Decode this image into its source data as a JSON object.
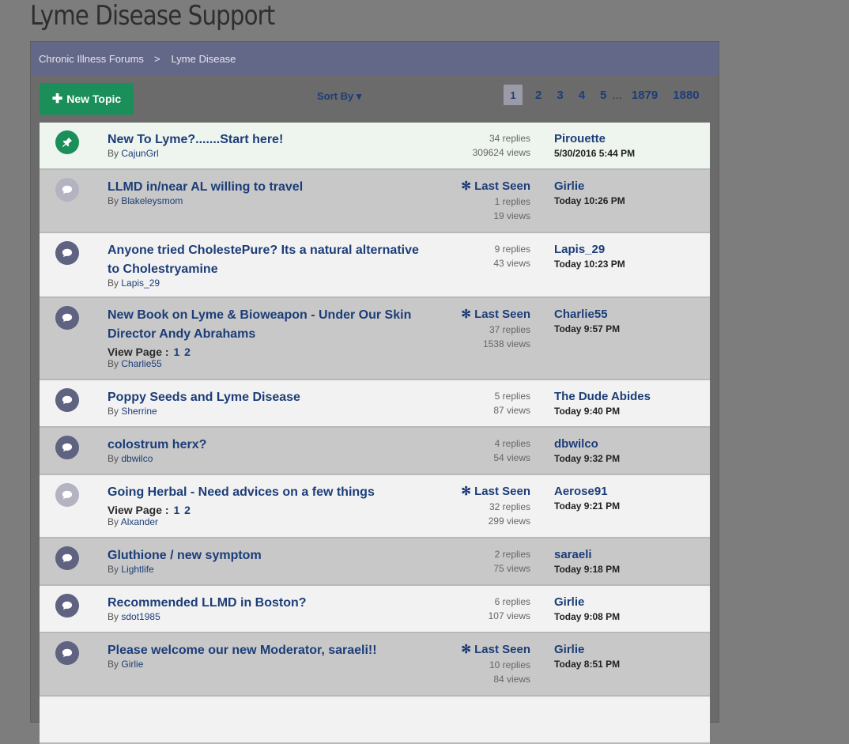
{
  "site": {
    "title": "Lyme Disease Support"
  },
  "breadcrumb": {
    "root": "Chronic Illness Forums",
    "separator": ">",
    "current": "Lyme Disease"
  },
  "toolbar": {
    "new_topic_label": "New Topic",
    "new_topic_icon": "plus-icon",
    "sort_by_label": "Sort By ▾"
  },
  "pager": {
    "pages": [
      "1",
      "2",
      "3",
      "4",
      "5"
    ],
    "ellipsis": "...",
    "last_pages": [
      "1879",
      "1880"
    ],
    "current": "1"
  },
  "colors": {
    "accent_green": "#1a8f5a",
    "link_blue": "#1c3d78",
    "breadcrumb_bg": "#646888"
  },
  "topics": [
    {
      "icon": "pin-icon",
      "title": "New To Lyme?.......Start here!",
      "by_label": "By",
      "author": "CajunGrl",
      "replies": "34 replies",
      "views": "309624 views",
      "last_user": "Pirouette",
      "last_time": "5/30/2016 5:44 PM"
    },
    {
      "icon": "chat-bubble-icon",
      "title": "LLMD in/near AL willing to travel",
      "by_label": "By",
      "author": "Blakeleysmom",
      "last_seen": "✻ Last Seen",
      "replies": "1 replies",
      "views": "19 views",
      "last_user": "Girlie",
      "last_time": "Today 10:26 PM"
    },
    {
      "icon": "chat-bubble-icon",
      "title": "Anyone tried CholestePure? Its a natural alternative to Cholestryamine",
      "by_label": "By",
      "author": "Lapis_29",
      "replies": "9 replies",
      "views": "43 views",
      "last_user": "Lapis_29",
      "last_time": "Today 10:23 PM"
    },
    {
      "icon": "chat-bubble-icon",
      "title": "New Book on Lyme & Bioweapon - Under Our Skin Director Andy Abrahams",
      "view_page_label": "View Page :",
      "view_pages": [
        "1",
        "2"
      ],
      "by_label": "By",
      "author": "Charlie55",
      "last_seen": "✻ Last Seen",
      "replies": "37 replies",
      "views": "1538 views",
      "last_user": "Charlie55",
      "last_time": "Today 9:57 PM"
    },
    {
      "icon": "chat-bubble-icon",
      "title": "Poppy Seeds and Lyme Disease",
      "by_label": "By",
      "author": "Sherrine",
      "replies": "5 replies",
      "views": "87 views",
      "last_user": "The Dude Abides",
      "last_time": "Today 9:40 PM"
    },
    {
      "icon": "chat-bubble-icon",
      "title": "colostrum herx?",
      "by_label": "By",
      "author": "dbwilco",
      "replies": "4 replies",
      "views": "54 views",
      "last_user": "dbwilco",
      "last_time": "Today 9:32 PM"
    },
    {
      "icon": "chat-bubble-icon",
      "title": "Going Herbal - Need advices on a few things",
      "view_page_label": "View Page :",
      "view_pages": [
        "1",
        "2"
      ],
      "by_label": "By",
      "author": "Alxander",
      "last_seen": "✻ Last Seen",
      "replies": "32 replies",
      "views": "299 views",
      "last_user": "Aerose91",
      "last_time": "Today 9:21 PM"
    },
    {
      "icon": "chat-bubble-icon",
      "title": "Gluthione / new symptom",
      "by_label": "By",
      "author": "Lightlife",
      "replies": "2 replies",
      "views": "75 views",
      "last_user": "saraeli",
      "last_time": "Today 9:18 PM"
    },
    {
      "icon": "chat-bubble-icon",
      "title": "Recommended LLMD in Boston?",
      "by_label": "By",
      "author": "sdot1985",
      "replies": "6 replies",
      "views": "107 views",
      "last_user": "Girlie",
      "last_time": "Today 9:08 PM"
    },
    {
      "icon": "chat-bubble-icon",
      "title": "Please welcome our new Moderator, saraeli!!",
      "by_label": "By",
      "author": "Girlie",
      "last_seen": "✻ Last Seen",
      "replies": "10 replies",
      "views": "84 views",
      "last_user": "Girlie",
      "last_time": "Today 8:51 PM"
    }
  ]
}
